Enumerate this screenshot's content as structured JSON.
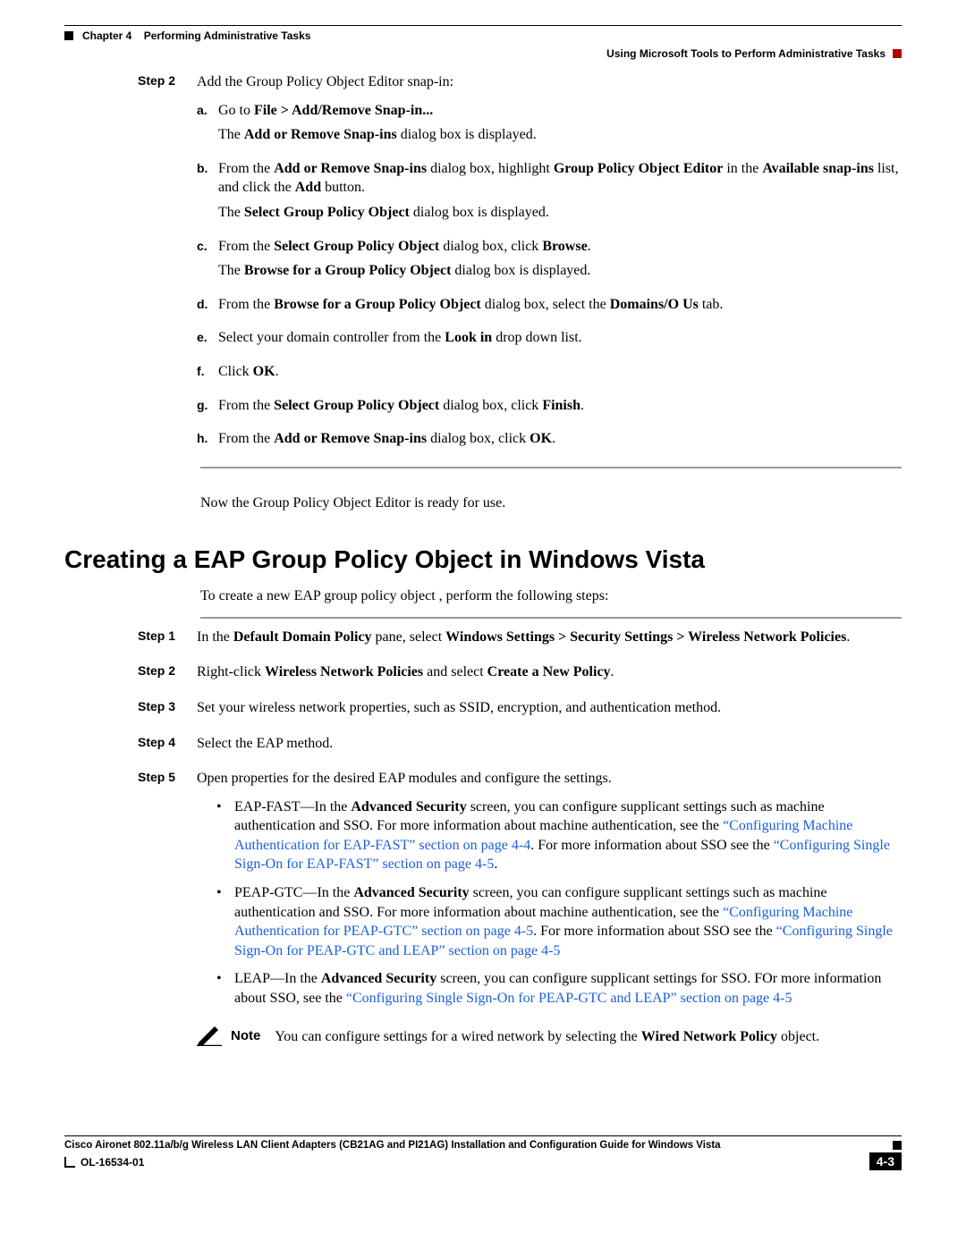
{
  "header": {
    "chapter_label": "Chapter 4",
    "chapter_title": "Performing Administrative Tasks",
    "section_title": "Using Microsoft Tools to Perform Administrative Tasks"
  },
  "first_procedure": {
    "step2": {
      "label": "Step 2",
      "text": "Add the Group Policy Object Editor snap-in:"
    },
    "substeps": {
      "a": {
        "marker": "a.",
        "line1_pre": "Go to ",
        "line1_bold": "File > Add/Remove Snap-in...",
        "line2_pre": "The ",
        "line2_bold": "Add or Remove Snap-ins",
        "line2_post": " dialog box is displayed."
      },
      "b": {
        "marker": "b.",
        "l1_a": "From the ",
        "l1_b": "Add or Remove Snap-ins",
        "l1_c": " dialog box, highlight ",
        "l1_d": "Group Policy Object Editor",
        "l1_e": " in the ",
        "l1_f": "Available snap-ins",
        "l1_g": " list, and click the ",
        "l1_h": "Add",
        "l1_i": " button.",
        "l2_a": "The ",
        "l2_b": "Select Group Policy Object",
        "l2_c": " dialog box is displayed."
      },
      "c": {
        "marker": "c.",
        "l1_a": "From the ",
        "l1_b": "Select Group Policy Object",
        "l1_c": " dialog box, click ",
        "l1_d": "Browse",
        "l1_e": ".",
        "l2_a": "The ",
        "l2_b": "Browse for a Group Policy Object",
        "l2_c": " dialog box is displayed."
      },
      "d": {
        "marker": "d.",
        "a": "From the ",
        "b": "Browse for a Group Policy Object",
        "c": " dialog box, select the ",
        "d": "Domains/O Us",
        "e": " tab."
      },
      "e": {
        "marker": "e.",
        "a": "Select your domain controller from the ",
        "b": "Look in",
        "c": " drop down list."
      },
      "f": {
        "marker": "f.",
        "a": "Click ",
        "b": "OK",
        "c": "."
      },
      "g": {
        "marker": "g.",
        "a": "From the ",
        "b": "Select Group Policy Object",
        "c": " dialog box, click ",
        "d": "Finish",
        "e": "."
      },
      "h": {
        "marker": "h.",
        "a": "From the ",
        "b": "Add or Remove Snap-ins",
        "c": " dialog box, click ",
        "d": "OK",
        "e": "."
      }
    },
    "conclusion": "Now the Group Policy Object Editor is ready for use."
  },
  "section_heading": "Creating a EAP Group Policy Object in Windows Vista",
  "section_intro": "To create a new EAP group policy object , perform the following steps:",
  "proc2": {
    "step1": {
      "label": "Step 1",
      "a": "In the ",
      "b": "Default Domain Policy",
      "c": " pane, select ",
      "d": "Windows Settings > Security Settings > Wireless Network Policies",
      "e": "."
    },
    "step2": {
      "label": "Step 2",
      "a": "Right-click ",
      "b": "Wireless Network Policies",
      "c": " and select ",
      "d": "Create a New Policy",
      "e": "."
    },
    "step3": {
      "label": "Step 3",
      "text": "Set your wireless network properties, such as SSID, encryption, and authentication method."
    },
    "step4": {
      "label": "Step 4",
      "text": "Select the EAP method."
    },
    "step5": {
      "label": "Step 5",
      "text": "Open properties for the desired EAP modules and configure the settings."
    },
    "bullets": {
      "b1": {
        "a": "EAP-FAST—In the ",
        "b": "Advanced Security",
        "c": " screen, you can configure supplicant settings such as machine authentication and SSO. For more information about machine authentication, see the ",
        "link1": "“Configuring Machine Authentication for EAP-FAST” section on page 4-4",
        "d": ". For more information about SSO see the ",
        "link2": "“Configuring Single Sign-On for EAP-FAST” section on page 4-5",
        "e": "."
      },
      "b2": {
        "a": "PEAP-GTC—In the ",
        "b": "Advanced Security",
        "c": " screen, you can configure supplicant settings such as machine authentication and SSO. For more information about machine authentication, see the ",
        "link1": "“Configuring Machine Authentication for PEAP-GTC” section on page 4-5",
        "d": ". For more information about SSO see the ",
        "link2": "“Configuring Single Sign-On for PEAP-GTC and LEAP” section on page 4-5"
      },
      "b3": {
        "a": "LEAP—In the ",
        "b": "Advanced Security",
        "c": " screen, you can configure supplicant settings for SSO. FOr more information about SSO, see the ",
        "link1": "“Configuring Single Sign-On for PEAP-GTC and LEAP” section on page 4-5"
      }
    },
    "note": {
      "label": "Note",
      "a": "You can configure settings for a wired network by selecting the ",
      "b": "Wired Network Policy",
      "c": " object."
    }
  },
  "footer": {
    "guide_title": "Cisco Aironet 802.11a/b/g Wireless LAN Client Adapters (CB21AG and PI21AG) Installation and Configuration Guide for Windows Vista",
    "doc_id": "OL-16534-01",
    "page_number": "4-3"
  }
}
